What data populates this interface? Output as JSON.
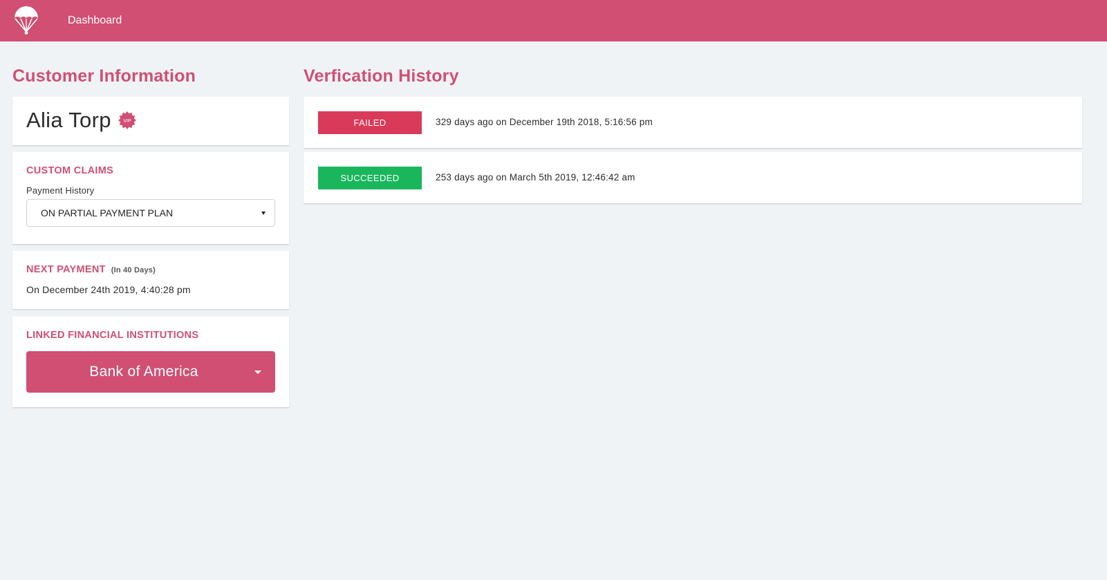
{
  "header": {
    "nav_label": "Dashboard",
    "brand_color": "#d04f73"
  },
  "customer_section": {
    "title": "Customer Information",
    "name": "Alia Torp",
    "vip_badge_text": "VIP",
    "custom_claims": {
      "heading": "CUSTOM CLAIMS",
      "field_label": "Payment History",
      "selected_value": "ON PARTIAL PAYMENT PLAN"
    },
    "next_payment": {
      "heading": "NEXT PAYMENT",
      "note": "(In 40 Days)",
      "date_text": "On December 24th 2019, 4:40:28 pm"
    },
    "linked_institutions": {
      "heading": "LINKED FINANCIAL INSTITUTIONS",
      "selected_bank": "Bank of America"
    }
  },
  "verification_section": {
    "title": "Verfication History",
    "items": [
      {
        "status": "FAILED",
        "status_color": "#d93a5a",
        "text": "329 days ago on December 19th 2018, 5:16:56 pm"
      },
      {
        "status": "SUCCEEDED",
        "status_color": "#1ab65c",
        "text": "253 days ago on March 5th 2019, 12:46:42 am"
      }
    ]
  }
}
